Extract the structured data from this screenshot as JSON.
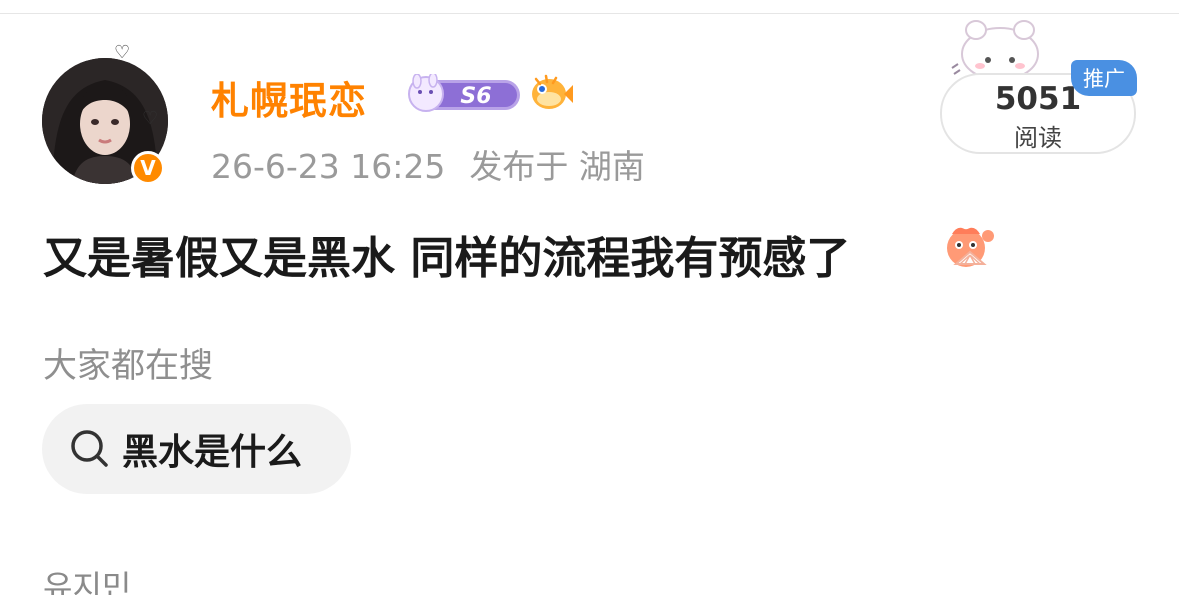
{
  "post": {
    "author": {
      "name": "札幌珉恋",
      "verify_badge": "V",
      "avatar": "avatar",
      "badges": {
        "level": "S6",
        "level_icon": "bunny-level-badge-icon",
        "fan_icon": "pufferfish-icon"
      }
    },
    "meta": {
      "timestamp": "26-6-23 16:25",
      "location": "发布于 湖南"
    },
    "reads": {
      "count": "5051",
      "label": "阅读"
    },
    "ad_tag": "推广",
    "content": "又是暑假又是黑水 同样的流程我有预感了",
    "content_emoji": "shy-fan-emoji-icon"
  },
  "search": {
    "heading": "大家都在搜",
    "chip_label": "黑水是什么",
    "chip_icon": "search-icon"
  },
  "next_post": {
    "author_name_partial": "유지민"
  },
  "colors": {
    "brand_orange": "#ff8200",
    "ad_blue": "#4a90e2",
    "meta_gray": "#9a9a9a",
    "chip_bg": "#f2f2f2"
  }
}
